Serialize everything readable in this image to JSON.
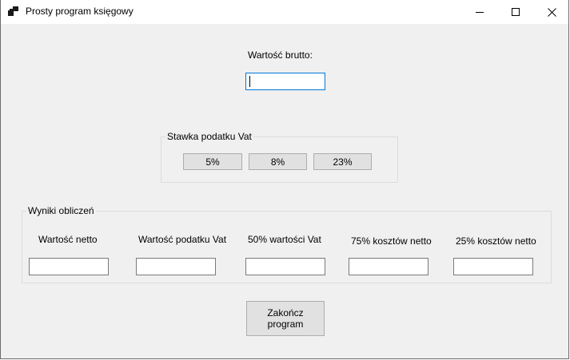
{
  "window": {
    "title": "Prosty program księgowy"
  },
  "input": {
    "label": "Wartość brutto:",
    "value": ""
  },
  "vat_group": {
    "title": "Stawka podatku Vat",
    "buttons": [
      "5%",
      "8%",
      "23%"
    ]
  },
  "results_group": {
    "title": "Wyniki obliczeń",
    "fields": [
      {
        "label": "Wartość netto",
        "value": ""
      },
      {
        "label": "Wartość podatku Vat",
        "value": ""
      },
      {
        "label": "50% wartości Vat",
        "value": ""
      },
      {
        "label": "75% kosztów netto",
        "value": ""
      },
      {
        "label": "25% kosztów netto",
        "value": ""
      }
    ]
  },
  "exit_button": {
    "label": "Zakończ\nprogram"
  },
  "icons": {
    "app": "app-icon",
    "minimize": "minimize-icon",
    "maximize": "maximize-icon",
    "close": "close-icon"
  },
  "colors": {
    "window_bg": "#f0f0f0",
    "focus_border": "#0078d7",
    "button_bg": "#e1e1e1"
  }
}
